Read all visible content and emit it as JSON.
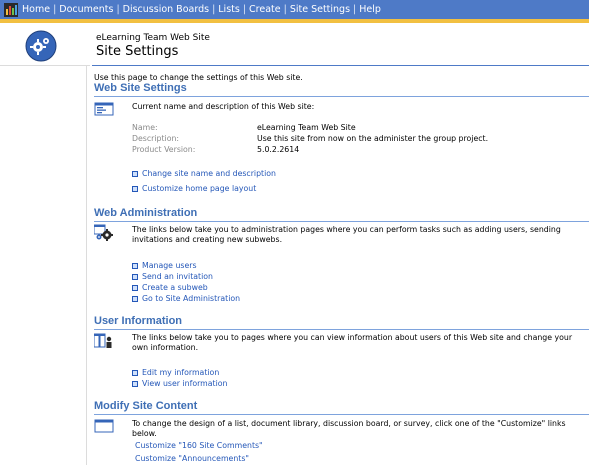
{
  "topnav": {
    "items": [
      "Home",
      "Documents",
      "Discussion Boards",
      "Lists",
      "Create",
      "Site Settings",
      "Help"
    ],
    "separator": "|"
  },
  "header": {
    "site_name": "eLearning Team Web Site",
    "page_title": "Site Settings"
  },
  "intro": "Use this page to change the settings of this Web site.",
  "web_site_settings": {
    "title": "Web Site Settings",
    "description": "Current name and description of this Web site:",
    "fields": [
      {
        "label": "Name:",
        "value": "eLearning Team Web Site"
      },
      {
        "label": "Description:",
        "value": "Use this site from now on the administer the group project."
      },
      {
        "label": "Product Version:",
        "value": "5.0.2.2614"
      }
    ],
    "links": [
      "Change site name and description",
      "Customize home page layout"
    ]
  },
  "web_administration": {
    "title": "Web Administration",
    "description": "The links below take you to administration pages where you can perform tasks such as adding users, sending invitations and creating new subwebs.",
    "links": [
      "Manage users",
      "Send an invitation",
      "Create a subweb",
      "Go to Site Administration"
    ]
  },
  "user_information": {
    "title": "User Information",
    "description": "The links below take you to pages where you can view information about users of this Web site and change your own information.",
    "links": [
      "Edit my information",
      "View user information"
    ]
  },
  "modify_site_content": {
    "title": "Modify Site Content",
    "description": "To change the design of a list, document library, discussion board, or survey, click one of the \"Customize\" links below.",
    "links": [
      "Customize \"160 Site Comments\"",
      "Customize \"Announcements\""
    ]
  },
  "colors": {
    "nav_bar": "#4e7ac7",
    "nav_accent": "#f2c041",
    "section_title": "#3f6fb5",
    "link": "#2457b8"
  }
}
